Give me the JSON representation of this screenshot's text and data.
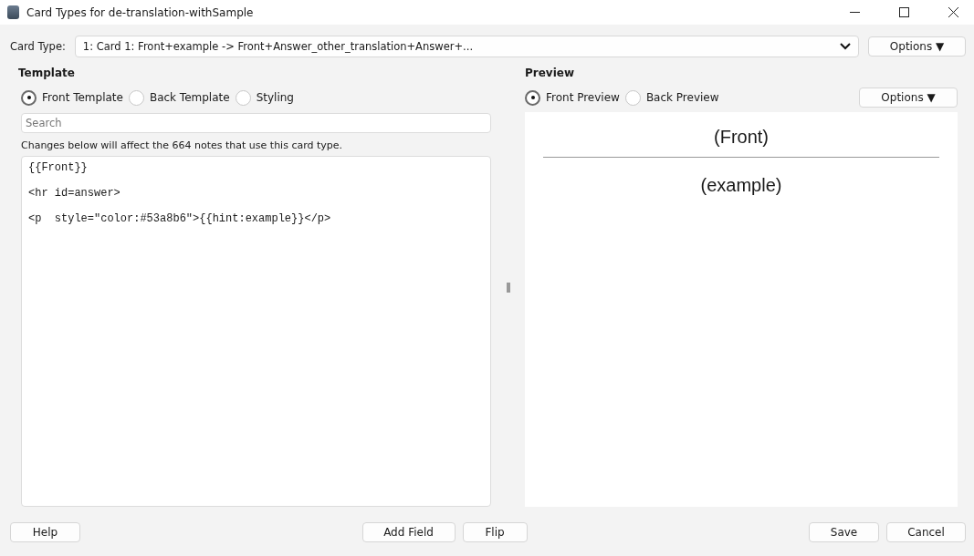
{
  "window": {
    "title": "Card Types for de-translation-withSample"
  },
  "card_type": {
    "label": "Card Type:",
    "value": "1: Card 1: Front+example -> Front+Answer_other_translation+Answer+...",
    "options_button": "Options ▼"
  },
  "template": {
    "heading": "Template",
    "tabs": [
      {
        "label": "Front Template",
        "selected": true
      },
      {
        "label": "Back Template",
        "selected": false
      },
      {
        "label": "Styling",
        "selected": false
      }
    ],
    "search": {
      "placeholder": "Search"
    },
    "notice": "Changes below will affect the 664 notes that use this card type.",
    "code_lines": [
      "{{Front}}",
      "<hr id=answer>",
      "<p  style=\"color:#53a8b6\">{{hint:example}}</p>"
    ]
  },
  "preview": {
    "heading": "Preview",
    "tabs": [
      {
        "label": "Front Preview",
        "selected": true
      },
      {
        "label": "Back Preview",
        "selected": false
      }
    ],
    "options_button": "Options ▼",
    "front": "(Front)",
    "answer": "(example)"
  },
  "buttons": {
    "left": [
      "Help"
    ],
    "center": [
      "Add Field",
      "Flip"
    ],
    "right": [
      "Save",
      "Cancel"
    ]
  }
}
